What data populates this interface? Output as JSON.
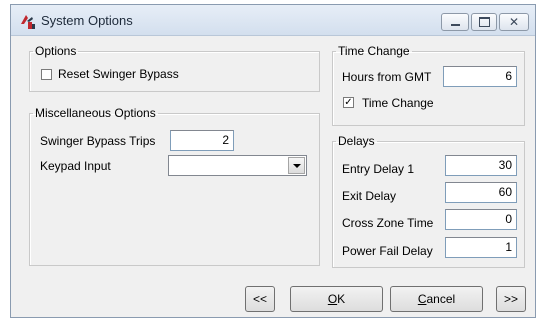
{
  "window": {
    "title": "System Options"
  },
  "options": {
    "legend": "Options",
    "reset_swinger_bypass": {
      "label": "Reset Swinger Bypass",
      "checked": false
    }
  },
  "misc": {
    "legend": "Miscellaneous Options",
    "swinger_bypass_trips": {
      "label": "Swinger Bypass Trips",
      "value": "2"
    },
    "keypad_input": {
      "label": "Keypad Input",
      "value": ""
    }
  },
  "time_change": {
    "legend": "Time Change",
    "hours_from_gmt": {
      "label": "Hours from GMT",
      "value": "6"
    },
    "time_change_checkbox": {
      "label": "Time Change",
      "checked": true
    }
  },
  "delays": {
    "legend": "Delays",
    "entry_delay_1": {
      "label": "Entry Delay 1",
      "value": "30"
    },
    "exit_delay": {
      "label": "Exit Delay",
      "value": "60"
    },
    "cross_zone_time": {
      "label": "Cross Zone Time",
      "value": "0"
    },
    "power_fail_delay": {
      "label": "Power Fail Delay",
      "value": "1"
    }
  },
  "buttons": {
    "prev": "<<",
    "ok_mnemonic": "O",
    "ok_rest": "K",
    "cancel_mnemonic": "C",
    "cancel_rest": "ancel",
    "next": ">>"
  },
  "icons": {
    "app": "app-logo-icon",
    "minimize": "minimize-icon",
    "maximize": "maximize-icon",
    "close": "close-icon",
    "dropdown": "chevron-down-icon",
    "check": "checkmark-icon"
  },
  "colors": {
    "logo_red": "#c0282e",
    "logo_dark": "#2b3a4a"
  }
}
